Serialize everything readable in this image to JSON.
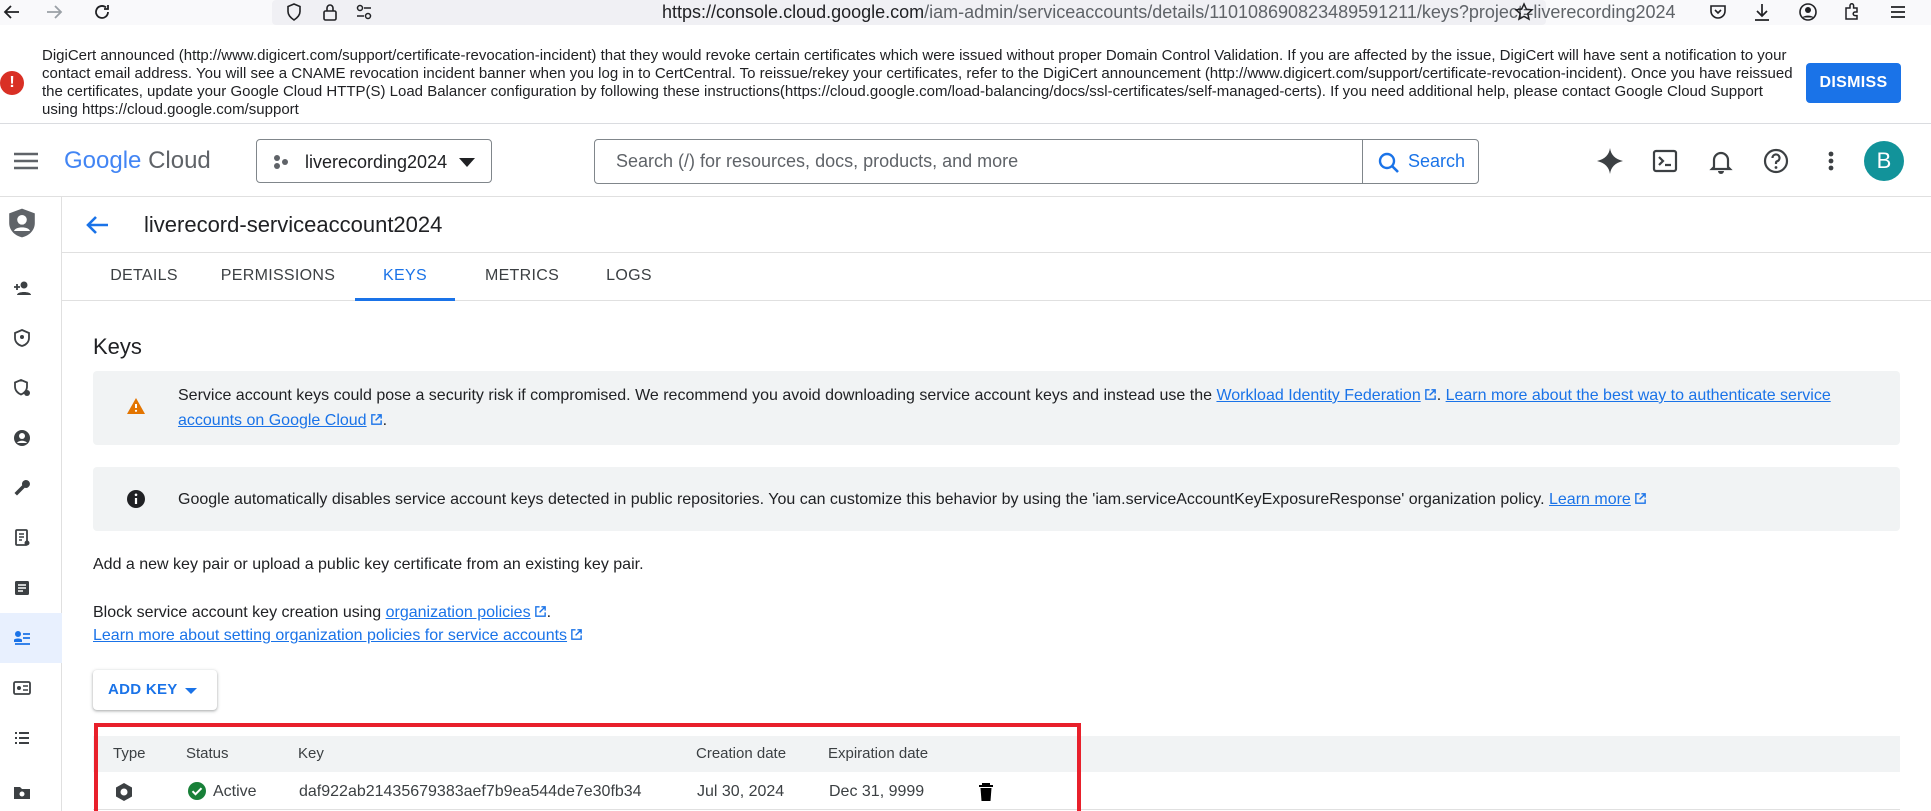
{
  "browser": {
    "url_host": "https://console.cloud.google.com",
    "url_path": "/iam-admin/serviceaccounts/details/110108690823489591211/keys?project=liverecording2024"
  },
  "banner": {
    "text": "DigiCert announced (http://www.digicert.com/support/certificate-revocation-incident) that they would revoke certain certificates which were issued without proper Domain Control Validation. If you are affected by the issue, DigiCert will have sent a notification to your contact email address. You will see a CNAME revocation incident banner when you log in to CertCentral. To reissue/rekey your certificates, refer to the DigiCert announcement (http://www.digicert.com/support/certificate-revocation-incident). Once you have reissued the certificates, update your Google Cloud HTTP(S) Load Balancer configuration by following these instructions(https://cloud.google.com/load-balancing/docs/ssl-certificates/self-managed-certs). If you need additional help, please contact Google Cloud Support using https://cloud.google.com/support",
    "dismiss_label": "DISMISS"
  },
  "header": {
    "logo_google": "Google",
    "logo_cloud": "Cloud",
    "project": "liverecording2024",
    "search_placeholder": "Search (/) for resources, docs, products, and more",
    "search_button": "Search",
    "avatar_initial": "B"
  },
  "page": {
    "title": "liverecord-serviceaccount2024",
    "tabs": [
      {
        "label": "DETAILS",
        "active": false
      },
      {
        "label": "PERMISSIONS",
        "active": false
      },
      {
        "label": "KEYS",
        "active": true
      },
      {
        "label": "METRICS",
        "active": false
      },
      {
        "label": "LOGS",
        "active": false
      }
    ],
    "section_heading": "Keys",
    "warning": {
      "text_before": "Service account keys could pose a security risk if compromised. We recommend you avoid downloading service account keys and instead use the ",
      "link1": "Workload Identity Federation",
      "sep": ". ",
      "link2": "Learn more about the best way to authenticate service accounts on Google Cloud",
      "text_after": "."
    },
    "info": {
      "text": "Google automatically disables service account keys detected in public repositories. You can customize this behavior by using the 'iam.serviceAccountKeyExposureResponse' organization policy. ",
      "link": "Learn more"
    },
    "add_description": "Add a new key pair or upload a public key certificate from an existing key pair.",
    "block_text": "Block service account key creation using ",
    "block_link": "organization policies",
    "block_after": ".",
    "learn_org_link": "Learn more about setting organization policies for service accounts",
    "add_key_label": "ADD KEY"
  },
  "table": {
    "columns": [
      "Type",
      "Status",
      "Key",
      "Creation date",
      "Expiration date"
    ],
    "rows": [
      {
        "type_icon": "key-type-icon",
        "status": "Active",
        "key": "daf922ab21435679383aef7b9ea544de7e30fb34",
        "creation_date": "Jul 30, 2024",
        "expiration_date": "Dec 31, 9999"
      }
    ]
  },
  "colors": {
    "accent": "#1a73e8",
    "active_status": "#188038",
    "highlight": "#e8202b",
    "warning": "#e37400"
  }
}
